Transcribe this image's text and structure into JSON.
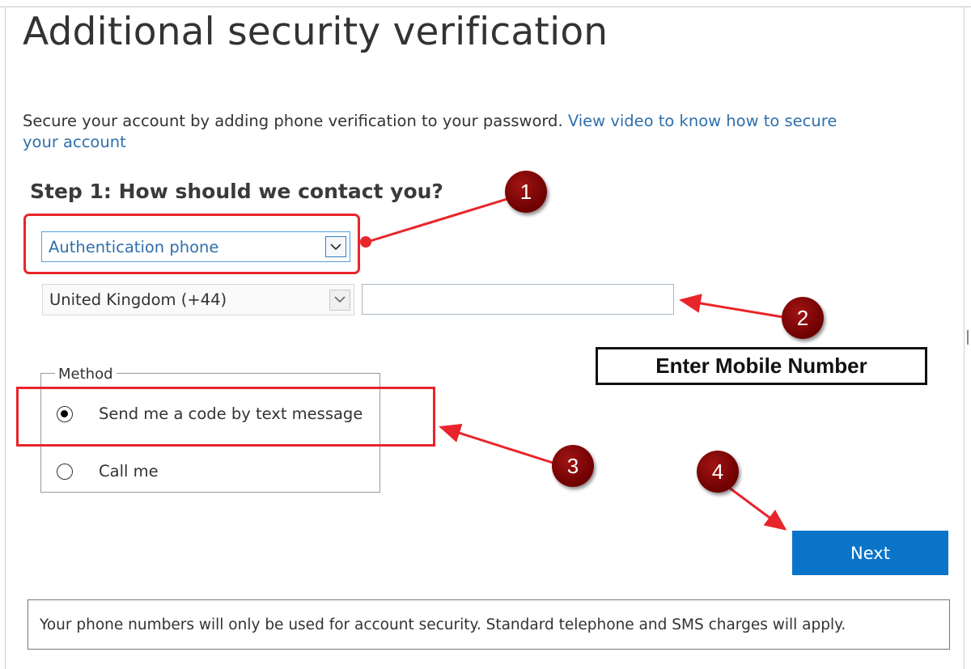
{
  "page": {
    "title": "Additional security verification",
    "intro_text": "Secure your account by adding phone verification to your password. ",
    "intro_link": "View video to know how to secure your account"
  },
  "step1": {
    "heading": "Step 1: How should we contact you?",
    "contact_method": "Authentication phone",
    "country_code": "United Kingdom (+44)",
    "phone_value": ""
  },
  "method": {
    "legend": "Method",
    "options": [
      {
        "label": "Send me a code by text message",
        "selected": true
      },
      {
        "label": "Call me",
        "selected": false
      }
    ]
  },
  "actions": {
    "next_label": "Next"
  },
  "footer": {
    "note": "Your phone numbers will only be used for account security. Standard telephone and SMS charges will apply."
  },
  "annotations": {
    "callout_text": "Enter Mobile Number",
    "badges": [
      "1",
      "2",
      "3",
      "4"
    ],
    "highlight_color": "#e8252a",
    "badge_color": "#7a0000"
  },
  "colors": {
    "link": "#2f6fac",
    "primary_button": "#0a74c9"
  }
}
